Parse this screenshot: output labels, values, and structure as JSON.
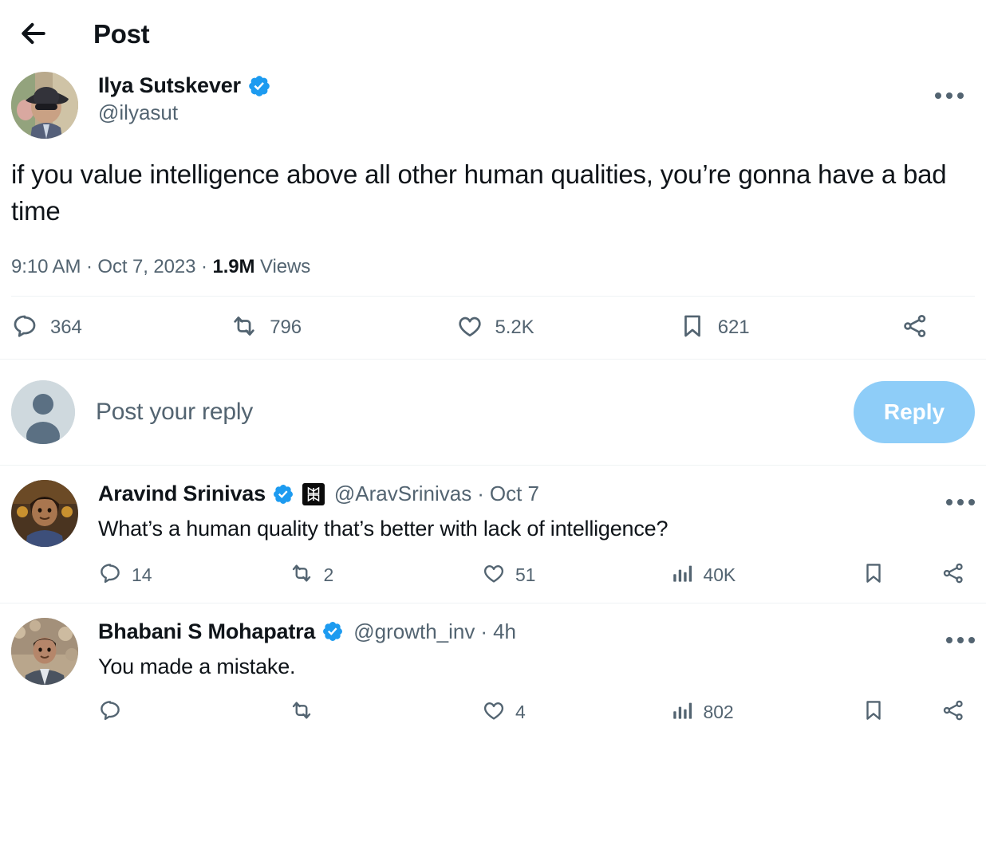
{
  "header": {
    "back_icon": "back-arrow-icon",
    "title": "Post",
    "more_icon": "more-options-icon"
  },
  "colors": {
    "text": "#0f1419",
    "muted": "#536471",
    "verified_blue": "#1d9bf0",
    "reply_button_bg": "#8ecdf8",
    "divider": "#eff3f4"
  },
  "post": {
    "author": {
      "display_name": "Ilya Sutskever",
      "handle": "@ilyasut",
      "verified": true,
      "verified_icon": "verified-badge-icon",
      "avatar_name": "avatar-ilya-sutskever"
    },
    "text": "if you value intelligence above all other human qualities, you’re gonna have a bad time",
    "meta": {
      "time": "9:10 AM",
      "separator_1": "·",
      "date": "Oct 7, 2023",
      "separator_2": "·",
      "views_count": "1.9M",
      "views_label": "Views"
    },
    "actions": [
      {
        "name": "reply",
        "icon": "reply-icon",
        "count": "364"
      },
      {
        "name": "repost",
        "icon": "repost-icon",
        "count": "796"
      },
      {
        "name": "like",
        "icon": "heart-icon",
        "count": "5.2K"
      },
      {
        "name": "bookmark",
        "icon": "bookmark-icon",
        "count": "621"
      },
      {
        "name": "share",
        "icon": "share-icon",
        "count": ""
      }
    ]
  },
  "composer": {
    "avatar_name": "avatar-default-user",
    "placeholder": "Post your reply",
    "reply_button_label": "Reply"
  },
  "replies": [
    {
      "author": {
        "display_name": "Aravind Srinivas",
        "handle": "@AravSrinivas",
        "verified": true,
        "verified_icon": "verified-badge-icon",
        "affiliate_icon": "affiliate-badge-icon",
        "avatar_name": "avatar-aravind-srinivas"
      },
      "dot": "·",
      "timestamp": "Oct 7",
      "text": "What’s a human quality that’s better with lack of intelligence?",
      "more_icon": "more-options-icon",
      "actions": [
        {
          "name": "reply",
          "icon": "reply-icon",
          "count": "14"
        },
        {
          "name": "repost",
          "icon": "repost-icon",
          "count": "2"
        },
        {
          "name": "like",
          "icon": "heart-icon",
          "count": "51"
        },
        {
          "name": "views",
          "icon": "analytics-icon",
          "count": "40K"
        },
        {
          "name": "bookmark",
          "icon": "bookmark-icon",
          "count": ""
        },
        {
          "name": "share",
          "icon": "share-icon",
          "count": ""
        }
      ]
    },
    {
      "author": {
        "display_name": "Bhabani S Mohapatra",
        "handle": "@growth_inv",
        "verified": true,
        "verified_icon": "verified-badge-icon",
        "affiliate_icon": "",
        "avatar_name": "avatar-bhabani-mohapatra"
      },
      "dot": "·",
      "timestamp": "4h",
      "text": "You made a mistake.",
      "more_icon": "more-options-icon",
      "actions": [
        {
          "name": "reply",
          "icon": "reply-icon",
          "count": ""
        },
        {
          "name": "repost",
          "icon": "repost-icon",
          "count": ""
        },
        {
          "name": "like",
          "icon": "heart-icon",
          "count": "4"
        },
        {
          "name": "views",
          "icon": "analytics-icon",
          "count": "802"
        },
        {
          "name": "bookmark",
          "icon": "bookmark-icon",
          "count": ""
        },
        {
          "name": "share",
          "icon": "share-icon",
          "count": ""
        }
      ]
    }
  ]
}
